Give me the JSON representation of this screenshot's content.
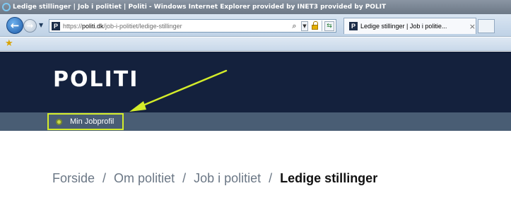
{
  "window": {
    "title": "Ledige stillinger | Job i politiet | Politi - Windows Internet Explorer provided by INET3 provided by POLIT"
  },
  "browser": {
    "url_prefix": "https://",
    "url_domain": "politi.dk",
    "url_path": "/job-i-politiet/ledige-stillinger",
    "favicon_letter": "P",
    "tab_label": "Ledige stillinger | Job i politie...",
    "tab_close": "×"
  },
  "icons": {
    "back": "arrow-left-icon",
    "forward": "arrow-right-icon",
    "search": "search-icon",
    "lock": "lock-icon",
    "refresh": "refresh-icon",
    "favorites": "star-icon"
  },
  "site": {
    "logo": "POLITI",
    "subnav": {
      "jobprofil_label": "Min Jobprofil"
    },
    "breadcrumb": {
      "items": [
        "Forside",
        "Om politiet",
        "Job i politiet"
      ],
      "separator": "/",
      "current": "Ledige stillinger"
    }
  },
  "colors": {
    "header_bg": "#14213d",
    "subnav_bg": "#495d74",
    "highlight": "#d4ec2a"
  }
}
